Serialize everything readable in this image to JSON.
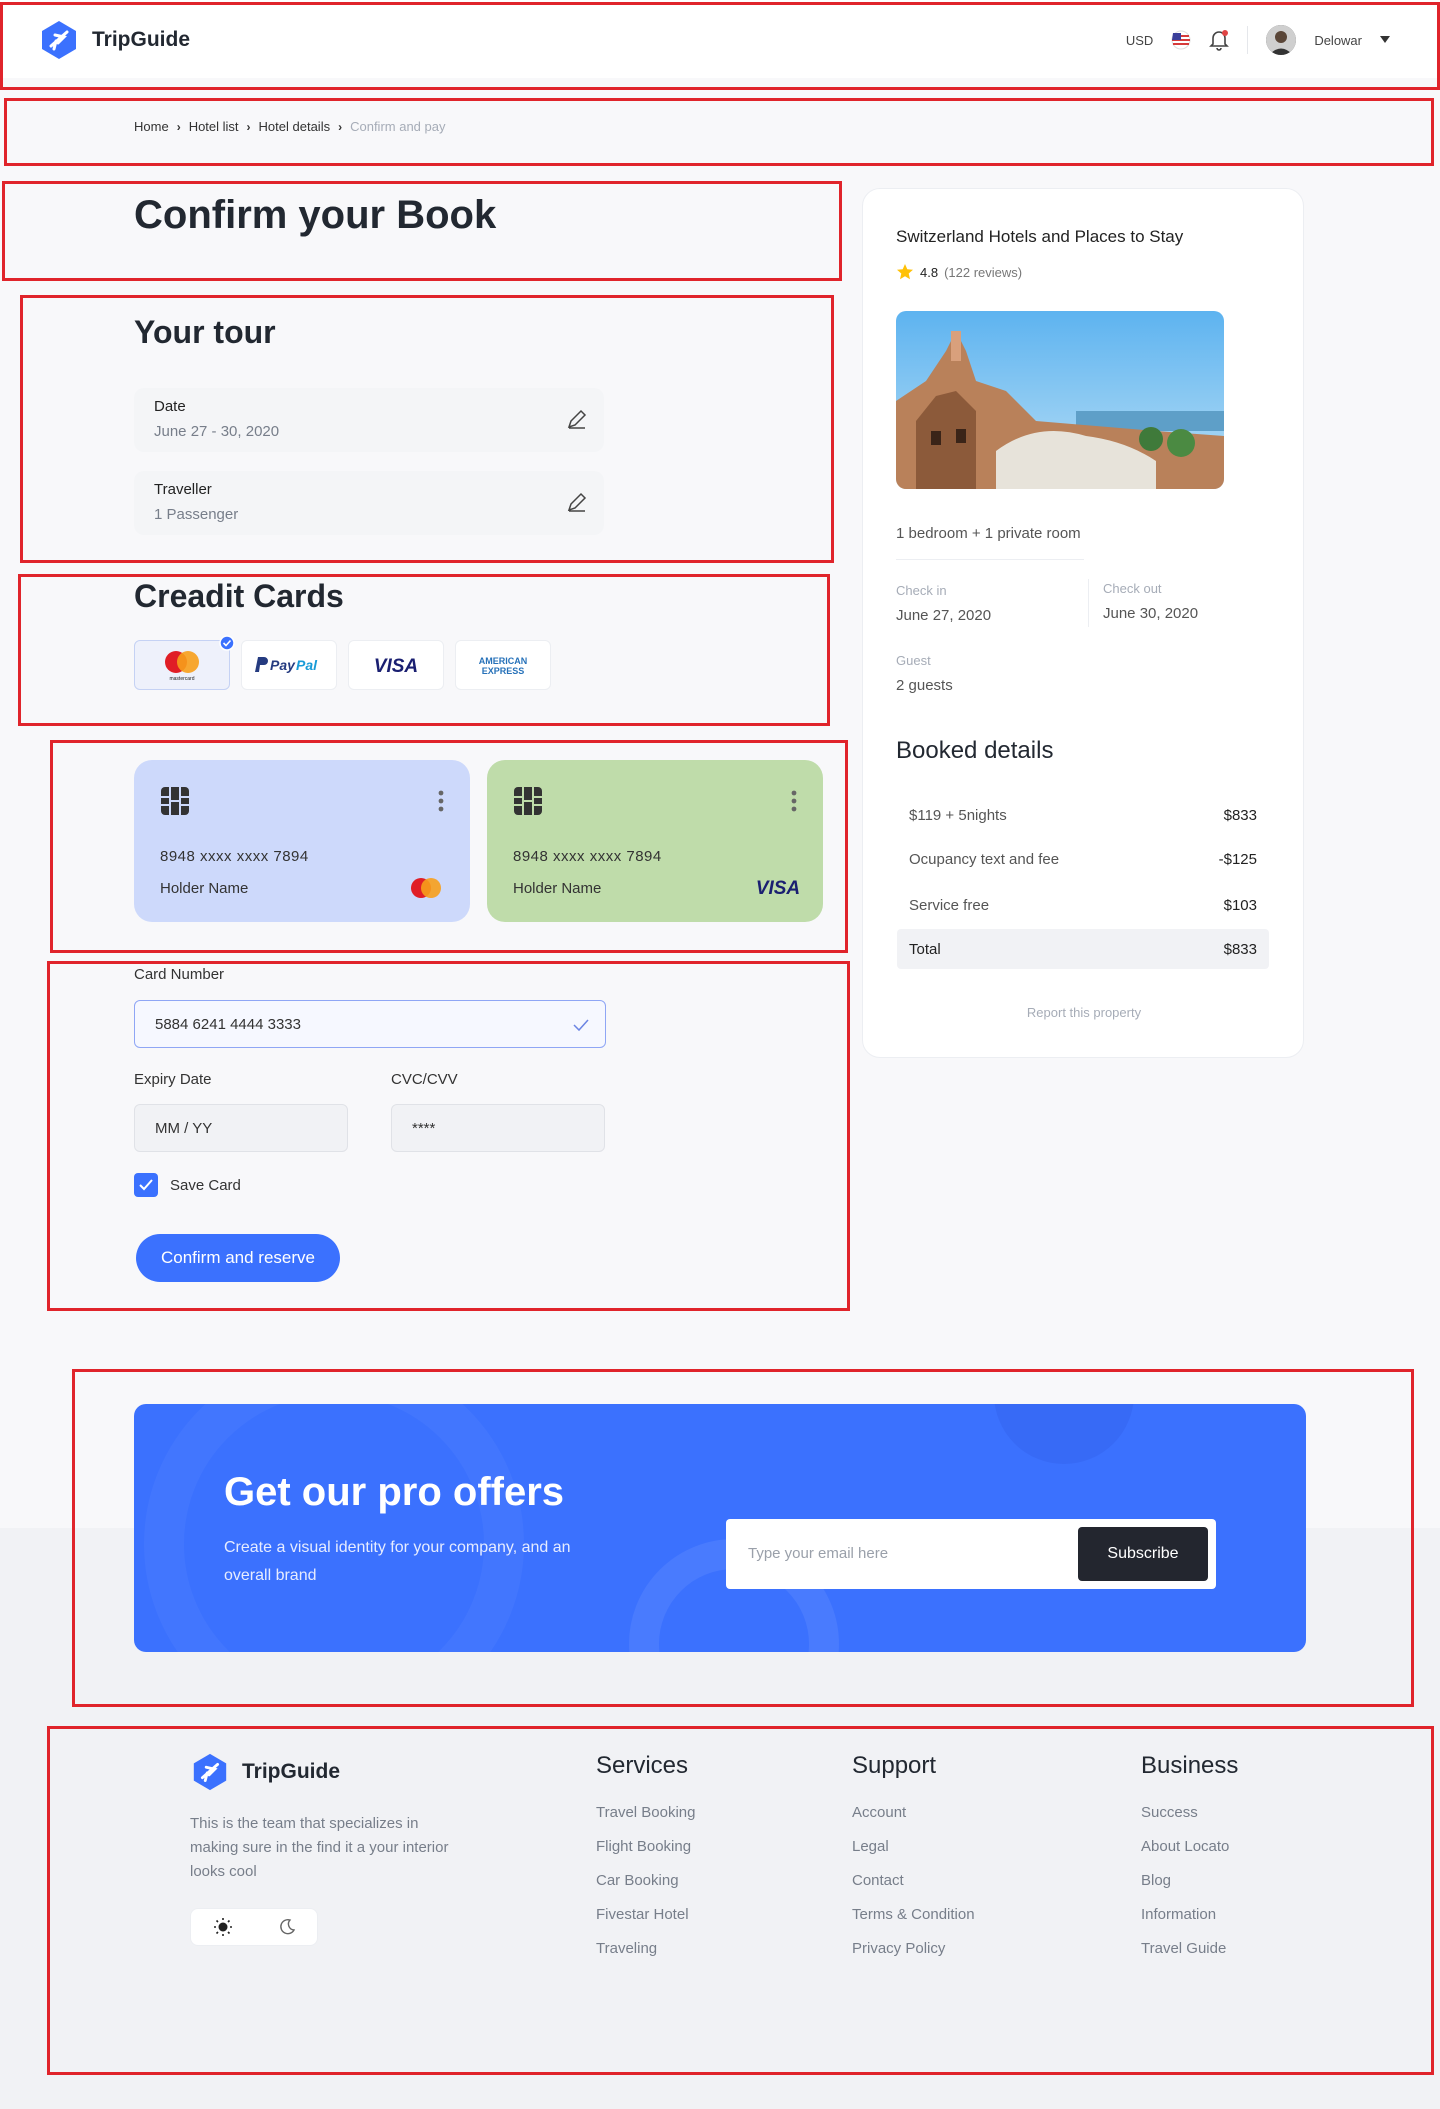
{
  "header": {
    "brand": "TripGuide",
    "currency": "USD",
    "user_name": "Delowar"
  },
  "breadcrumb": {
    "items": [
      "Home",
      "Hotel list",
      "Hotel details"
    ],
    "current": "Confirm and pay"
  },
  "page": {
    "title": "Confirm your Book"
  },
  "tour": {
    "heading": "Your tour",
    "date_label": "Date",
    "date_value": "June 27 - 30, 2020",
    "traveller_label": "Traveller",
    "traveller_value": "1 Passenger"
  },
  "credit": {
    "heading": "Creadit Cards",
    "methods": [
      "mastercard",
      "PayPal",
      "VISA",
      "AMERICAN EXPRESS"
    ],
    "selected": "mastercard"
  },
  "cards": [
    {
      "number": "8948  xxxx  xxxx  7894",
      "holder": "Holder Name",
      "brand": "mastercard",
      "color": "#cdd9fb"
    },
    {
      "number": "8948  xxxx  xxxx  7894",
      "holder": "Holder Name",
      "brand": "VISA",
      "color": "#bfdcaa"
    }
  ],
  "form": {
    "card_number_label": "Card Number",
    "card_number_value": "5884 6241 4444 3333",
    "expiry_label": "Expiry Date",
    "expiry_placeholder": "MM / YY",
    "cvc_label": "CVC/CVV",
    "cvc_placeholder": "****",
    "save_card_label": "Save Card",
    "save_card_checked": true,
    "submit_label": "Confirm and reserve"
  },
  "summary": {
    "hotel_name": "Switzerland Hotels and Places to Stay",
    "rating": "4.8",
    "reviews": "(122 reviews)",
    "rooms": "1 bedroom  +  1 private room",
    "check_in_label": "Check in",
    "check_in_value": "June 27, 2020",
    "check_out_label": "Check out",
    "check_out_value": "June 30, 2020",
    "guest_label": "Guest",
    "guest_value": "2 guests",
    "booked_heading": "Booked details",
    "lines": [
      {
        "label": "$119  +  5nights",
        "amount": "$833"
      },
      {
        "label": "Ocupancy text and fee",
        "amount": "-$125"
      },
      {
        "label": "Service free",
        "amount": "$103"
      }
    ],
    "total_label": "Total",
    "total_amount": "$833",
    "report_link": "Report this property"
  },
  "promo": {
    "title": "Get our pro offers",
    "text": "Create a visual identity for your company, and an overall brand",
    "email_placeholder": "Type your email here",
    "subscribe_label": "Subscribe"
  },
  "footer": {
    "brand": "TripGuide",
    "description": "This is the team that specializes in making sure in the find it a your interior looks cool",
    "columns": [
      {
        "heading": "Services",
        "items": [
          "Travel Booking",
          "Flight Booking",
          "Car Booking",
          "Fivestar Hotel",
          "Traveling"
        ]
      },
      {
        "heading": "Support",
        "items": [
          "Account",
          "Legal",
          "Contact",
          "Terms & Condition",
          "Privacy Policy"
        ]
      },
      {
        "heading": "Business",
        "items": [
          "Success",
          "About Locato",
          "Blog",
          "Information",
          "Travel Guide"
        ]
      }
    ]
  },
  "colors": {
    "accent": "#3b71fe",
    "highlight_box": "#e0242b",
    "dark": "#23262f"
  }
}
